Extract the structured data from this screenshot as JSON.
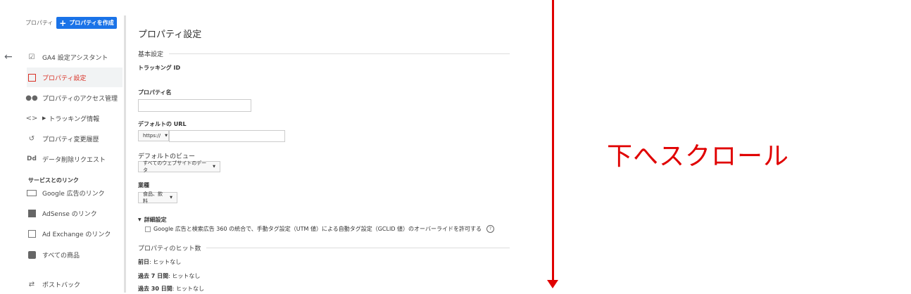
{
  "sidebar": {
    "property_label": "プロパティ",
    "create_button": "プロパティを作成",
    "items": [
      {
        "label": "GA4 設定アシスタント",
        "icon": "checkbox-icon"
      },
      {
        "label": "プロパティ設定",
        "icon": "window-icon",
        "active": true
      },
      {
        "label": "プロパティのアクセス管理",
        "icon": "people-icon"
      },
      {
        "label": "トラッキング情報",
        "icon": "code-icon"
      },
      {
        "label": "プロパティ変更履歴",
        "icon": "history-icon"
      },
      {
        "label": "データ削除リクエスト",
        "icon": "dd-icon"
      }
    ],
    "links_section_title": "サービスとのリンク",
    "link_items": [
      {
        "label": "Google 広告のリンク",
        "icon": "ads-icon"
      },
      {
        "label": "AdSense のリンク",
        "icon": "adsense-icon"
      },
      {
        "label": "Ad Exchange のリンク",
        "icon": "adexchange-icon"
      },
      {
        "label": "すべての商品",
        "icon": "products-icon"
      },
      {
        "label": "ポストバック",
        "icon": "postback-icon"
      }
    ],
    "dd_glyph": "Dd",
    "code_glyph": "<>"
  },
  "main": {
    "title": "プロパティ設定",
    "basic_settings": "基本設定",
    "tracking_id_label": "トラッキング ID",
    "property_name_label": "プロパティ名",
    "property_name_value": "",
    "default_url_label": "デフォルトの URL",
    "protocol_value": "https://",
    "url_value": "",
    "default_view_label": "デフォルトのビュー",
    "default_view_value": "すべてのウェブサイトのデータ",
    "industry_label": "業種",
    "industry_value": "食品、飲料",
    "advanced_label": "詳細設定",
    "advanced_checkbox_text": "Google 広告と検索広告 360 の統合で、手動タグ設定（UTM 値）による自動タグ設定（GCLID 値）のオーバーライドを許可する",
    "hits_section": "プロパティのヒット数",
    "hits": [
      {
        "period": "前日",
        "value": "ヒットなし"
      },
      {
        "period": "過去 7 日間",
        "value": "ヒットなし"
      },
      {
        "period": "過去 30 日間",
        "value": "ヒットなし"
      }
    ],
    "help_glyph": "?"
  },
  "annotation": {
    "scroll_text": "下へスクロール",
    "color": "#e00000"
  }
}
